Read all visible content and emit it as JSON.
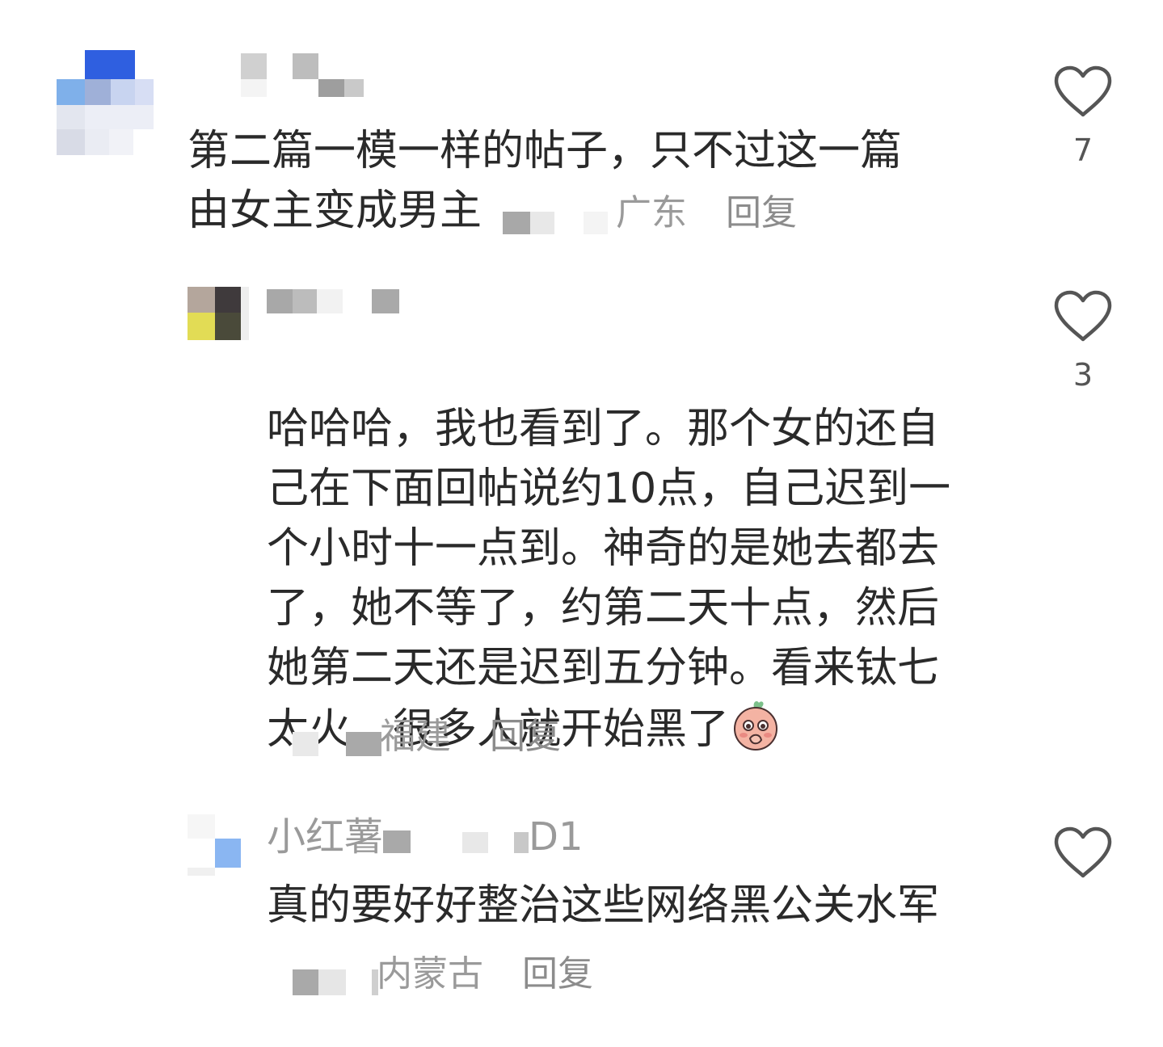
{
  "comments": [
    {
      "text": "第二篇一模一样的帖子，只不过这一篇\n由女主变成男主",
      "location": "广东",
      "reply_label": "回复",
      "likes": "7"
    },
    {
      "text": "哈哈哈，我也看到了。那个女的还自\n己在下面回帖说约10点，自己迟到一\n个小时十一点到。神奇的是她去都去\n了，她不等了，约第二天十点，然后\n她第二天还是迟到五分钟。看来钛七\n太火，很多人就开始黑了",
      "emoji": "shy-peach-emoji",
      "location": "福建",
      "reply_label": "回复",
      "likes": "3"
    },
    {
      "author": "小红薯",
      "author_suffix": "D1",
      "text": "真的要好好整治这些网络黑公关水军",
      "location": "内蒙古",
      "reply_label": "回复"
    }
  ],
  "icons": {
    "like": "heart-outline-icon"
  },
  "colors": {
    "text": "#2a2a2a",
    "meta": "#9a9a9a",
    "icon": "#555555"
  }
}
